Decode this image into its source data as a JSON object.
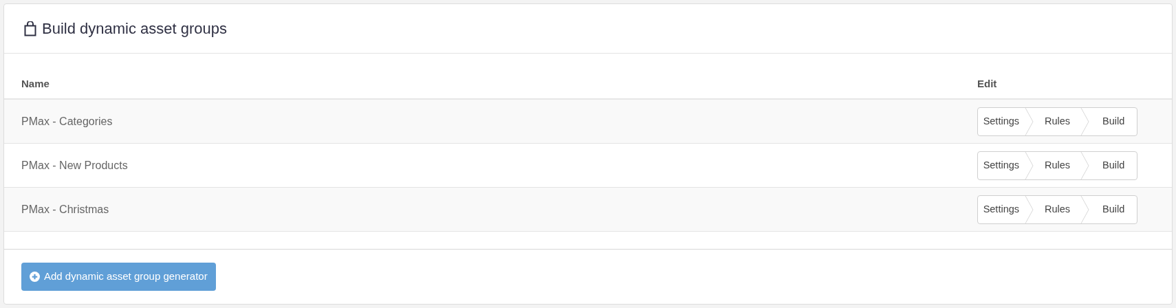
{
  "panel": {
    "title": "Build dynamic asset groups"
  },
  "table": {
    "columns": [
      "Name",
      "Edit"
    ],
    "rows": [
      {
        "name": "PMax - Categories",
        "steps": [
          "Settings",
          "Rules",
          "Build"
        ]
      },
      {
        "name": "PMax - New Products",
        "steps": [
          "Settings",
          "Rules",
          "Build"
        ]
      },
      {
        "name": "PMax - Christmas",
        "steps": [
          "Settings",
          "Rules",
          "Build"
        ]
      }
    ]
  },
  "add_button": "Add dynamic asset group generator"
}
